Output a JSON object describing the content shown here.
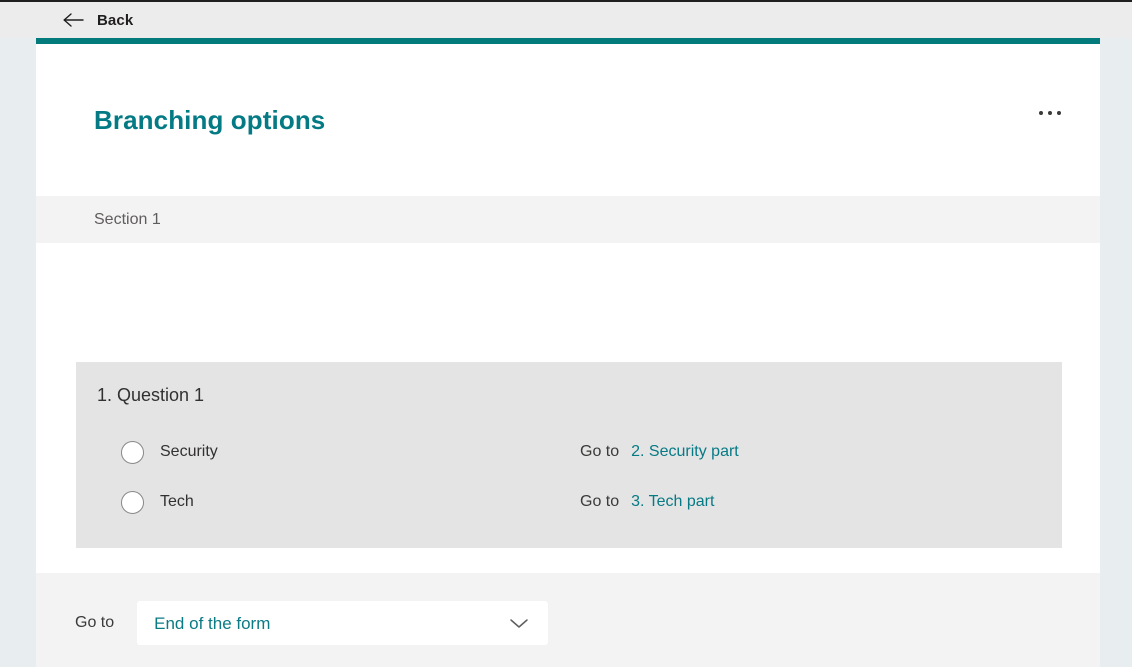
{
  "topbar": {
    "back_label": "Back",
    "back_icon": "arrow-left-icon"
  },
  "header": {
    "title": "Branching options",
    "more_icon": "ellipsis-horizontal-icon",
    "accent_color": "#037b7c",
    "title_color": "#047a84"
  },
  "section": {
    "label": "Section 1"
  },
  "question": {
    "title": "1. Question 1",
    "choices": [
      {
        "label": "Security",
        "radio_icon": "radio-unchecked-icon",
        "goto_prefix": "Go to",
        "goto_target": "2. Security part"
      },
      {
        "label": "Tech",
        "radio_icon": "radio-unchecked-icon",
        "goto_prefix": "Go to",
        "goto_target": "3. Tech part"
      }
    ]
  },
  "footer": {
    "goto_label": "Go to",
    "dropdown_value": "End of the form",
    "dropdown_icon": "chevron-down-icon",
    "options": [
      "End of the form"
    ]
  }
}
